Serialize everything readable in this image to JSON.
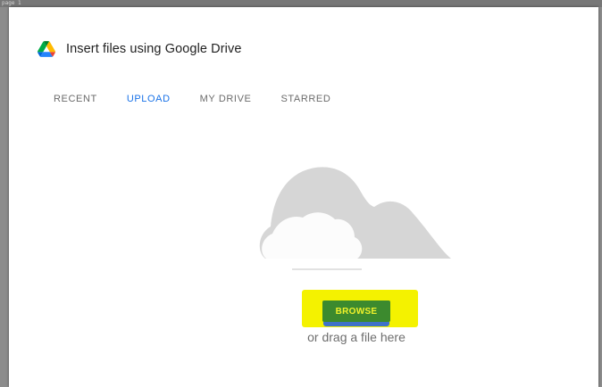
{
  "window": {
    "frame_label": "page 1"
  },
  "dialog": {
    "title": "Insert files using Google Drive",
    "logo_icon": "google-drive-icon"
  },
  "tabs": [
    {
      "label": "RECENT",
      "active": false
    },
    {
      "label": "UPLOAD",
      "active": true
    },
    {
      "label": "MY DRIVE",
      "active": false
    },
    {
      "label": "STARRED",
      "active": false
    }
  ],
  "upload": {
    "illustration_icon": "cloud-upload-icon",
    "browse_label": "BROWSE",
    "drag_text": "or drag a file here"
  },
  "colors": {
    "accent_tab": "#1a73e8",
    "highlight": "#f4f200",
    "button_bg": "#3c8a2e",
    "drive_green": "#0f9d58",
    "drive_yellow": "#f4b400",
    "drive_blue": "#4285f4"
  }
}
